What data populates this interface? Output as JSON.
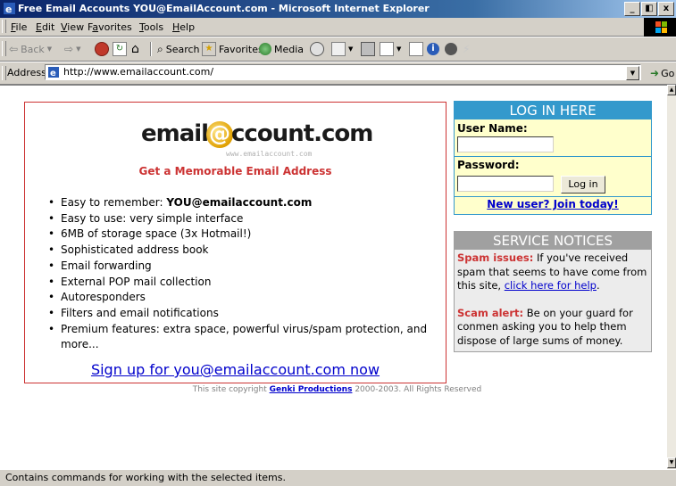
{
  "window": {
    "title": "Free Email Accounts YOU@EmailAccount.com - Microsoft Internet Explorer",
    "controls": {
      "minimize": "_",
      "restore": "◧",
      "close": "x"
    }
  },
  "menubar": {
    "items": [
      {
        "label": "File",
        "access": "F"
      },
      {
        "label": "Edit",
        "access": "E"
      },
      {
        "label": "View",
        "access": "V"
      },
      {
        "label": "Favorites",
        "access": "a"
      },
      {
        "label": "Tools",
        "access": "T"
      },
      {
        "label": "Help",
        "access": "H"
      }
    ]
  },
  "toolbar": {
    "back_label": "Back",
    "search_label": "Search",
    "favorites_label": "Favorites",
    "media_label": "Media"
  },
  "addressbar": {
    "label": "Address",
    "url": "http://www.emailaccount.com/",
    "go_label": "Go"
  },
  "page": {
    "logo": {
      "text_left": "email",
      "text_at": "@",
      "text_right": "ccount.com",
      "sub": "www.emailaccount.com"
    },
    "tagline": "Get a Memorable Email Address",
    "features": [
      {
        "text": "Easy to remember: ",
        "bold": "YOU@emailaccount.com"
      },
      {
        "text": "Easy to use: very simple interface",
        "bold": ""
      },
      {
        "text": "6MB of storage space (3x Hotmail!)",
        "bold": ""
      },
      {
        "text": "Sophisticated address book",
        "bold": ""
      },
      {
        "text": "Email forwarding",
        "bold": ""
      },
      {
        "text": "External POP mail collection",
        "bold": ""
      },
      {
        "text": "Autoresponders",
        "bold": ""
      },
      {
        "text": "Filters and email notifications",
        "bold": ""
      },
      {
        "text": "Premium features: extra space, powerful virus/spam protection, and more...",
        "bold": ""
      }
    ],
    "signup_link": "Sign up for you@emailaccount.com now",
    "login": {
      "heading": "LOG IN HERE",
      "username_label": "User Name:",
      "username_value": "",
      "password_label": "Password:",
      "password_value": "",
      "button_label": "Log in",
      "newuser_link": "New user? Join today!"
    },
    "notices": {
      "heading": "SERVICE NOTICES",
      "spam_title": "Spam issues:",
      "spam_text": " If you've received spam that seems to have come from this site, ",
      "spam_link": "click here for help",
      "spam_end": ".",
      "scam_title": "Scam alert:",
      "scam_text": " Be on your guard for conmen asking you to help them dispose of large sums of money."
    },
    "copyright": {
      "prefix": "This site copyright ",
      "link": "Genki Productions",
      "suffix": " 2000-2003. All Rights Reserved"
    }
  },
  "status": {
    "text": "Contains commands for working with the selected items."
  },
  "colors": {
    "accent_blue": "#3399cc",
    "brand_red": "#cc3333",
    "link": "#0000cc",
    "notice_gray": "#a0a0a0"
  }
}
